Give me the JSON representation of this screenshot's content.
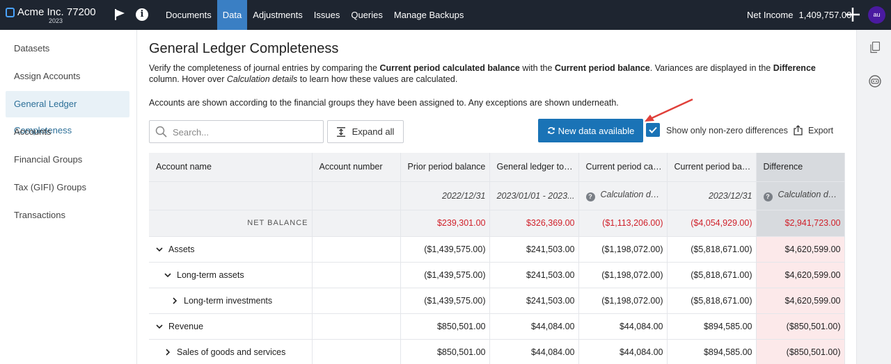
{
  "app": {
    "name": "Acme Inc. 77200",
    "year": "2023"
  },
  "nav": [
    "Documents",
    "Data",
    "Adjustments",
    "Issues",
    "Queries",
    "Manage Backups"
  ],
  "header": {
    "net_income_label": "Net Income",
    "net_income_value": "1,409,757.00",
    "avatar": "au"
  },
  "sidebar": [
    "Datasets",
    "Assign Accounts",
    "General Ledger Completeness",
    "Accounts",
    "Financial Groups",
    "Tax (GIFI) Groups",
    "Transactions"
  ],
  "page": {
    "title": "General Ledger Completeness",
    "desc": {
      "p1": "Verify the completeness of journal entries by comparing the ",
      "b1": "Current period calculated balance",
      "p2": " with the ",
      "b2": "Current period balance",
      "p3": ". Variances are displayed in the ",
      "b3": "Difference",
      "p4": " column. Hover over ",
      "i1": "Calculation details",
      "p5": " to learn how these values are calculated."
    },
    "desc2": "Accounts are shown according to the financial groups they have been assigned to. Any exceptions are shown underneath."
  },
  "toolbar": {
    "search_placeholder": "Search...",
    "expand_label": "Expand all",
    "new_data_label": "New data available",
    "checkbox_label": "Show only non-zero differences",
    "export_label": "Export"
  },
  "table": {
    "headers": [
      "Account name",
      "Account number",
      "Prior period balance",
      "General ledger total ...",
      "Current period calcu...",
      "Current period balan...",
      "Difference"
    ],
    "subheaders": [
      "2022/12/31",
      "2023/01/01 - 2023...",
      "Calculation details",
      "2023/12/31",
      "Calculation details"
    ],
    "net": {
      "label": "NET BALANCE",
      "values": [
        "$239,301.00",
        "$326,369.00",
        "($1,113,206.00)",
        "($4,054,929.00)",
        "$2,941,723.00"
      ]
    },
    "rows": [
      {
        "name": "Assets",
        "values": [
          "($1,439,575.00)",
          "$241,503.00",
          "($1,198,072.00)",
          "($5,818,671.00)",
          "$4,620,599.00"
        ]
      },
      {
        "name": "Long-term assets",
        "values": [
          "($1,439,575.00)",
          "$241,503.00",
          "($1,198,072.00)",
          "($5,818,671.00)",
          "$4,620,599.00"
        ]
      },
      {
        "name": "Long-term investments",
        "values": [
          "($1,439,575.00)",
          "$241,503.00",
          "($1,198,072.00)",
          "($5,818,671.00)",
          "$4,620,599.00"
        ]
      },
      {
        "name": "Revenue",
        "values": [
          "$850,501.00",
          "$44,084.00",
          "$44,084.00",
          "$894,585.00",
          "($850,501.00)"
        ]
      },
      {
        "name": "Sales of goods and services",
        "values": [
          "$850,501.00",
          "$44,084.00",
          "$44,084.00",
          "$894,585.00",
          "($850,501.00)"
        ]
      }
    ]
  },
  "colors": {
    "topbar": "#1e2530",
    "accent": "#1a73b6",
    "negative": "#d0202a",
    "diff_bg": "#fce9ea"
  }
}
